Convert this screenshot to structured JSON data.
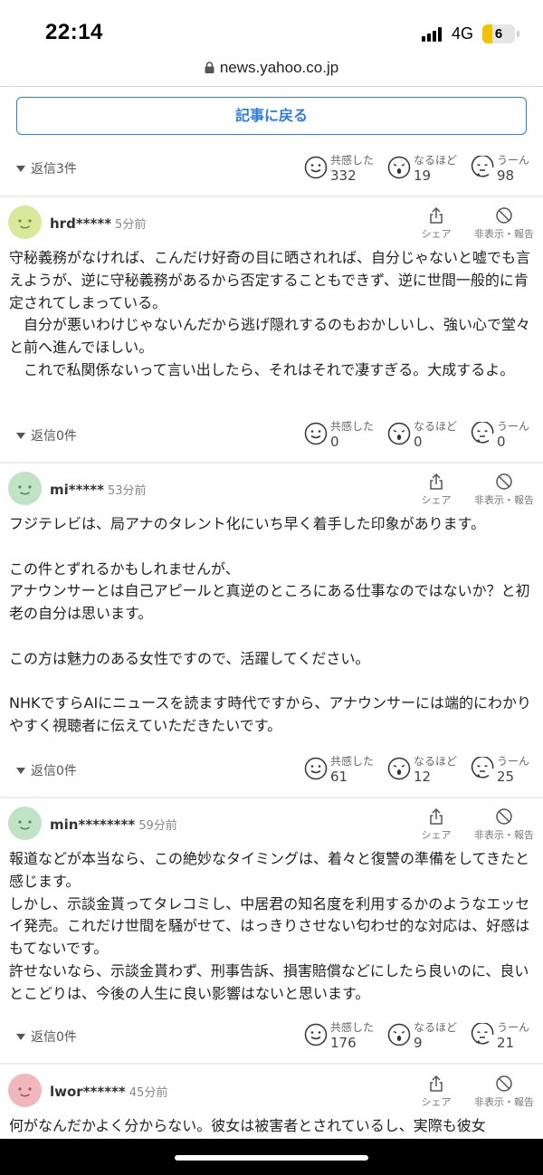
{
  "status_bar": {
    "time": "22:14",
    "network": "4G",
    "battery": "6"
  },
  "url_bar": {
    "url": "news.yahoo.co.jp"
  },
  "back_button": {
    "label": "記事に戻る"
  },
  "reaction_labels": {
    "empathy": "共感した",
    "insight": "なるほど",
    "hmm": "うーん"
  },
  "action_labels": {
    "share": "シェア",
    "report": "非表示・報告"
  },
  "colors": {
    "accent": "#2d7de0",
    "avatar_yellow": "#d9e89a",
    "avatar_green": "#bfe3c4",
    "avatar_pink": "#f0b7bd"
  },
  "top_reply_row": {
    "replies": "返信3件",
    "empathy": "332",
    "insight": "19",
    "hmm": "98"
  },
  "comments": [
    {
      "user": "hrd*****",
      "time": "5分前",
      "body": "守秘義務がなければ、こんだけ好奇の目に晒されれば、自分じゃないと嘘でも言えようが、逆に守秘義務があるから否定することもできず、逆に世間一般的に肯定されてしまっている。\n　自分が悪いわけじゃないんだから逃げ隠れするのもおかしいし、強い心で堂々と前へ進んでほしい。\n　これで私関係ないって言い出したら、それはそれで凄すぎる。大成するよ。",
      "replies": "返信0件",
      "empathy": "0",
      "insight": "0",
      "hmm": "0"
    },
    {
      "user": "mi*****",
      "time": "53分前",
      "body": "フジテレビは、局アナのタレント化にいち早く着手した印象があります。\n\nこの件とずれるかもしれませんが、\nアナウンサーとは自己アピールと真逆のところにある仕事なのではないか？と初老の自分は思います。\n\nこの方は魅力のある女性ですので、活躍してください。\n\nNHKですらAIにニュースを読ます時代ですから、アナウンサーには端的にわかりやすく視聴者に伝えていただきたいです。",
      "replies": "返信0件",
      "empathy": "61",
      "insight": "12",
      "hmm": "25"
    },
    {
      "user": "min********",
      "time": "59分前",
      "body": "報道などが本当なら、この絶妙なタイミングは、着々と復讐の準備をしてきたと感じます。\nしかし、示談金貰ってタレコミし、中居君の知名度を利用するかのようなエッセイ発売。これだけ世間を騒がせて、はっきりさせない匂わせ的な対応は、好感はもてないです。\n許せないなら、示談金貰わず、刑事告訴、損害賠償などにしたら良いのに、良いとこどりは、今後の人生に良い影響はないと思います。",
      "replies": "返信0件",
      "empathy": "176",
      "insight": "9",
      "hmm": "21"
    },
    {
      "user": "lwor******",
      "time": "45分前",
      "body": "何がなんだかよく分からない。彼女は被害者とされているし、実際も彼女"
    }
  ]
}
